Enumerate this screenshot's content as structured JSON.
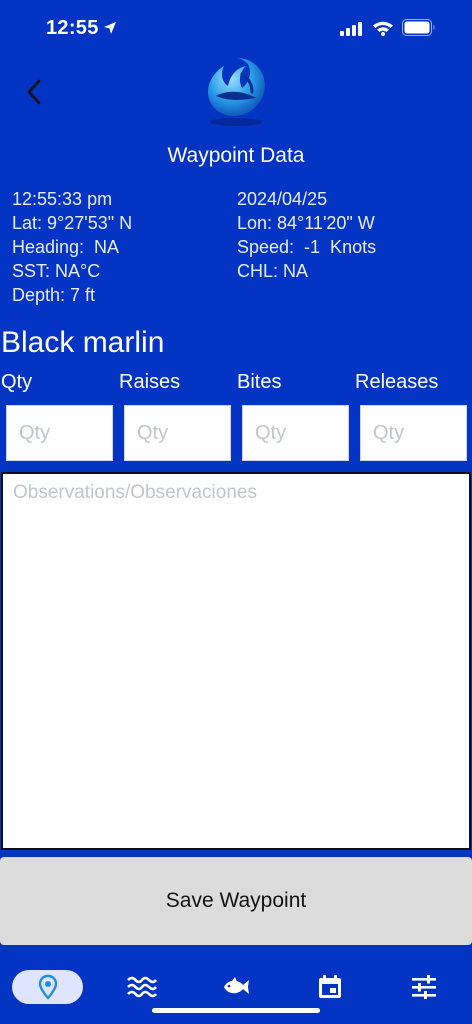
{
  "status": {
    "time": "12:55"
  },
  "header": {
    "title": "Waypoint Data"
  },
  "info": {
    "time": "12:55:33 pm",
    "date": "2024/04/25",
    "lat": "Lat: 9°27'53\" N",
    "lon": "Lon: 84°11'20\" W",
    "heading": "Heading:  NA",
    "speed": "Speed:  -1  Knots",
    "sst": "SST: NA°C",
    "chl": "CHL: NA",
    "depth": "Depth: 7 ft"
  },
  "species": "Black marlin",
  "columns": [
    "Qty",
    "Raises",
    "Bites",
    "Releases"
  ],
  "inputs": {
    "placeholder": "Qty"
  },
  "observations": {
    "placeholder": "Observations/Observaciones"
  },
  "save_button": "Save Waypoint",
  "tabs": [
    {
      "icon": "location-pin-icon",
      "active": true
    },
    {
      "icon": "waves-icon",
      "active": false
    },
    {
      "icon": "fish-icon",
      "active": false
    },
    {
      "icon": "calendar-icon",
      "active": false
    },
    {
      "icon": "sliders-icon",
      "active": false
    }
  ],
  "colors": {
    "background": "#0434c4",
    "button": "#dcdcdc",
    "active_tab": "#dfe4ff",
    "pin": "#1e8fe0"
  }
}
